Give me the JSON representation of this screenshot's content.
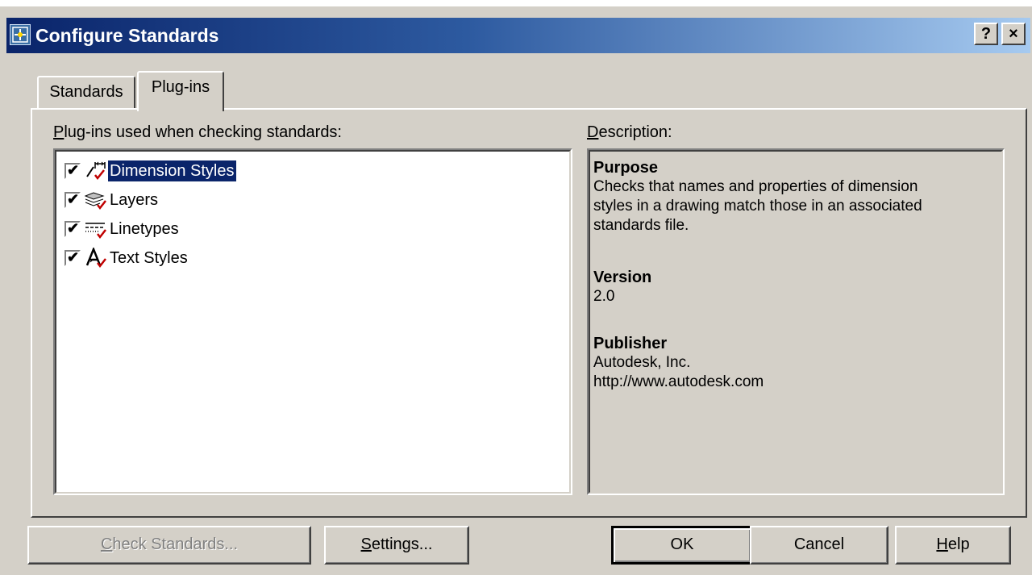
{
  "window": {
    "title": "Configure Standards",
    "help_button": "?",
    "close_button": "×"
  },
  "tabs": [
    {
      "label": "Standards",
      "active": false
    },
    {
      "label": "Plug-ins",
      "active": true
    }
  ],
  "plugins_panel": {
    "list_label": "Plug-ins used when checking standards:",
    "list_label_accel": "P",
    "list_label_rest": "lug-ins used when checking standards:",
    "items": [
      {
        "label": "Dimension Styles",
        "checked": true,
        "selected": true,
        "icon": "dimension-styles-icon"
      },
      {
        "label": "Layers",
        "checked": true,
        "selected": false,
        "icon": "layers-icon"
      },
      {
        "label": "Linetypes",
        "checked": true,
        "selected": false,
        "icon": "linetypes-icon"
      },
      {
        "label": "Text Styles",
        "checked": true,
        "selected": false,
        "icon": "text-styles-icon"
      }
    ]
  },
  "description": {
    "label_accel": "D",
    "label_rest": "escription:",
    "purpose_heading": "Purpose",
    "purpose_lines": [
      "Checks that names and properties of dimension",
      "styles in a drawing match those in an associated",
      "standards file."
    ],
    "version_heading": "Version",
    "version_value": "2.0",
    "publisher_heading": "Publisher",
    "publisher_lines": [
      "Autodesk, Inc.",
      "http://www.autodesk.com"
    ]
  },
  "buttons": {
    "check_standards_accel": "C",
    "check_standards_rest": "heck Standards...",
    "settings_accel": "S",
    "settings_rest": "ettings...",
    "ok": "OK",
    "cancel": "Cancel",
    "help_accel": "H",
    "help_rest": "elp"
  },
  "colors": {
    "face": "#d4d0c8",
    "title_start": "#0a246a",
    "title_end": "#a6caf0",
    "selection": "#0a246a"
  }
}
